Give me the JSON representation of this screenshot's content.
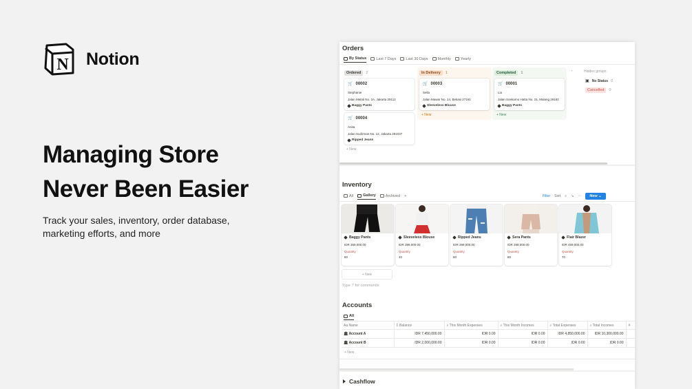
{
  "brand": {
    "name": "Notion",
    "logo_letter": "N"
  },
  "hero": {
    "headline_line1": "Managing Store",
    "headline_line2": "Never Been Easier",
    "subtext": "Track your sales, inventory, order database, marketing efforts, and more"
  },
  "orders": {
    "title": "Orders",
    "views": [
      "By Status",
      "Last 7 Days",
      "Last 30 Days",
      "Monthly",
      "Yearly"
    ],
    "columns": [
      {
        "label": "Ordered",
        "count": "2",
        "color": "#e3e2e0",
        "cards": [
          {
            "id": "00002",
            "customer": "Stephanie",
            "address": "Jalan Melati No. 2A, Jakarta 29112",
            "product": "Baggy Pants"
          },
          {
            "id": "00004",
            "customer": "Anita",
            "address": "Jalan Sudirman No. 12, Jakarta 291037",
            "product": "Ripped Jeans"
          }
        ],
        "new_label": "+ New"
      },
      {
        "label": "In Delivery",
        "count": "1",
        "color": "#fadec9",
        "cards": [
          {
            "id": "00003",
            "customer": "Sella",
            "address": "Jalan Mawar No. 14, Bekasi 27161",
            "product": "Sleeveless Blouse"
          }
        ],
        "new_label": "+ New"
      },
      {
        "label": "Completed",
        "count": "1",
        "color": "#dbeddb",
        "cards": [
          {
            "id": "00001",
            "customer": "Lia",
            "address": "Jalan Soekarno Hatta No. 21, Malang 29182",
            "product": "Baggy Pants"
          }
        ],
        "new_label": "+ New"
      }
    ],
    "hidden_groups_label": "Hidden groups",
    "hidden_groups": [
      {
        "label": "No Status",
        "count": "0"
      },
      {
        "label": "Cancelled",
        "count": "0"
      }
    ]
  },
  "inventory": {
    "title": "Inventory",
    "views": [
      "All",
      "Gallery",
      "Archived"
    ],
    "toolbar": {
      "filter": "Filter",
      "sort": "Sort",
      "new": "New"
    },
    "items": [
      {
        "name": "Baggy Pants",
        "price": "IDR 359,000.00",
        "qty_label": "Quantity",
        "qty": "80"
      },
      {
        "name": "Sleeveless Blouse",
        "price": "IDR 399,000.00",
        "qty_label": "Quantity",
        "qty": "40"
      },
      {
        "name": "Ripped Jeans",
        "price": "IDR 399,000.00",
        "qty_label": "Quantity",
        "qty": "60"
      },
      {
        "name": "Sera Pants",
        "price": "IDR 299,000.00",
        "qty_label": "Quantity",
        "qty": "80"
      },
      {
        "name": "Flair Blazer",
        "price": "IDR 459,000.00",
        "qty_label": "Quantity",
        "qty": "70"
      }
    ],
    "new_label": "+ New",
    "command_hint": "Type '/' for commands"
  },
  "accounts": {
    "title": "Accounts",
    "view": "All",
    "headers": [
      "Aa Name",
      "Balance",
      "This Month Expenses",
      "This Month Incomes",
      "Total Expenses",
      "Total Incomes"
    ],
    "rows": [
      [
        "Account A",
        "IDR 7,450,000.00",
        "IDR 0.00",
        "IDR 0.00",
        "IDR 4,850,000.00",
        "IDR 10,300,000.00"
      ],
      [
        "Account B",
        "IDR 2,000,000.00",
        "IDR 0.00",
        "IDR 0.00",
        "IDR 0.00",
        "IDR 0.00"
      ]
    ],
    "new_label": "+ New"
  },
  "cashflow": {
    "title": "Cashflow"
  }
}
